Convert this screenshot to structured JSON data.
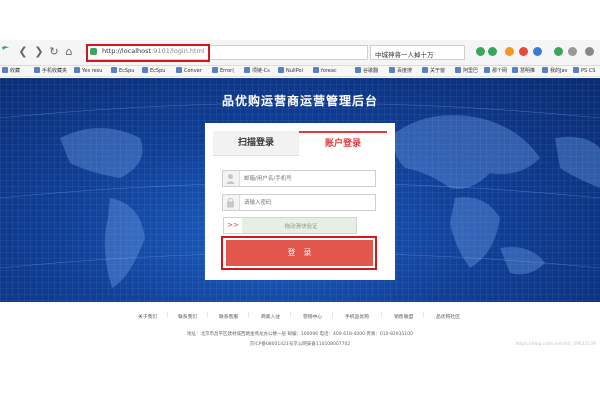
{
  "browser": {
    "url_host": "http://localhost",
    "url_rest": ":9101/login.html",
    "search_text": "中城神将一人掉十万",
    "icon_colors": {
      "green": "#3aa55f",
      "orange": "#f29a1f",
      "red": "#e64a3c",
      "blue": "#3b7bd4"
    }
  },
  "bookmarks": [
    "收藏",
    "手机收藏夹",
    "Yes resu",
    "EcSpu",
    "EcSpu",
    "Conver",
    "Error(",
    "项链-Cs",
    "NullPoi",
    "foreac",
    "谷歌翻",
    "百度搜",
    "关于窗",
    "阿里巴",
    "那个网",
    "慧明推",
    "我的Jav",
    "PS CS"
  ],
  "banner": {
    "title": "品优购运营商运营管理后台"
  },
  "login": {
    "tab_scan": "扫描登录",
    "tab_account": "账户登录",
    "username_placeholder": "邮箱/用户名/手机号",
    "password_placeholder": "请输入密码",
    "captcha_arrows": ">>",
    "captcha_text": "拖动滑块验证",
    "login_button": "登　录"
  },
  "footer": {
    "links": [
      "关于我们",
      "联系我们",
      "联系客服",
      "商家入驻",
      "营销中心",
      "手机品优购",
      "销售联盟",
      "品优购社区"
    ],
    "address": "地址：北京市昌平区建材城西路金燕龙办公楼一层 邮编：100096 电话：400-618-4000 传真：010-82935100",
    "icp": "京ICP备08001421号京公网安备110108007702",
    "watermark": "https://blog.csdn.net/m0_49632139"
  }
}
